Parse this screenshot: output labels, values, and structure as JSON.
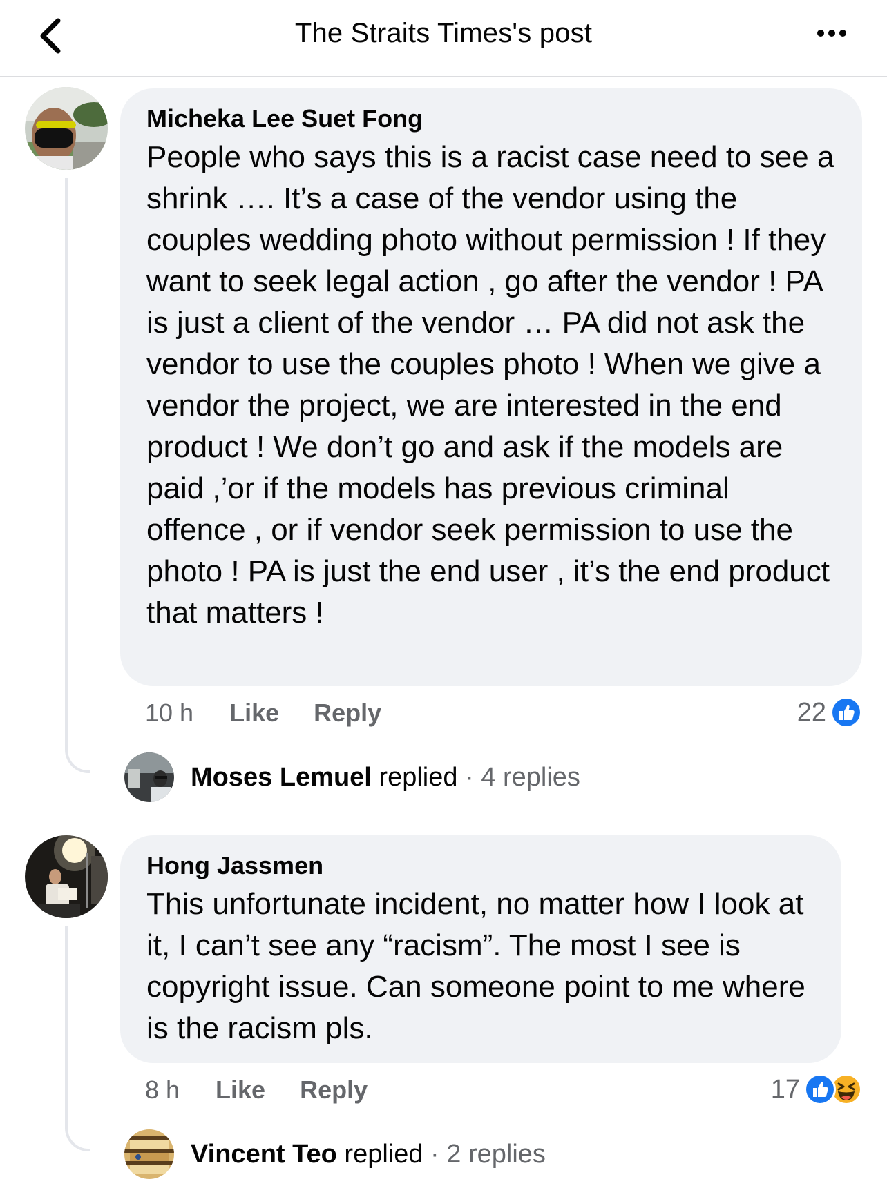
{
  "header": {
    "title": "The Straits Times's post",
    "back_icon": "chevron-left-icon",
    "more_icon": "more-horizontal-icon"
  },
  "comments": [
    {
      "author": "Micheka Lee Suet Fong",
      "text": "People who says this is a racist case need to see a shrink …. It’s a case of the vendor using the couples wedding photo without permission ! If they want to seek legal action , go after the vendor ! PA is just a client of the vendor … PA did not ask the vendor to use the couples photo ! When we give a vendor the project, we are interested in the end product ! We don’t go and ask if the models are paid ,’or if the models has previous criminal offence , or if vendor seek permission to use the photo ! PA is just the end user , it’s the end product that matters !",
      "time": "10 h",
      "like_label": "Like",
      "reply_label": "Reply",
      "reaction_count": "22",
      "reactions": [
        "like-reaction-icon"
      ],
      "replied": {
        "name": "Moses Lemuel",
        "verb": " replied",
        "count": " · 4 replies"
      }
    },
    {
      "author": "Hong Jassmen",
      "text": "This unfortunate incident, no matter how I look at it, I can’t see any “racism”. The most I see is copyright issue. Can someone point to me where is the racism pls.",
      "time": "8 h",
      "like_label": "Like",
      "reply_label": "Reply",
      "reaction_count": "17",
      "reactions": [
        "like-reaction-icon",
        "haha-reaction-icon"
      ],
      "replied": {
        "name": "Vincent Teo",
        "verb": " replied",
        "count": " · 2 replies"
      }
    }
  ],
  "colors": {
    "bubble": "#f0f2f5",
    "meta_text": "#65676b",
    "like_blue": "#1877f2",
    "haha_yellow": "#f7b125"
  }
}
